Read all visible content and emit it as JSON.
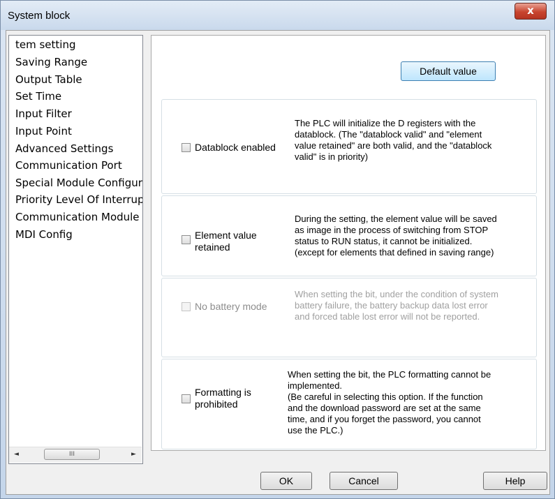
{
  "window": {
    "title": "System block",
    "close_label": "x"
  },
  "sidebar": {
    "items": [
      {
        "label": "tem setting"
      },
      {
        "label": "Saving Range"
      },
      {
        "label": "Output Table"
      },
      {
        "label": "Set Time"
      },
      {
        "label": "Input Filter"
      },
      {
        "label": "Input Point"
      },
      {
        "label": "Advanced Settings"
      },
      {
        "label": "Communication Port"
      },
      {
        "label": "Special Module Configur"
      },
      {
        "label": "Priority Level Of Interrupt"
      },
      {
        "label": "Communication Module"
      },
      {
        "label": "MDI Config"
      }
    ],
    "scroll": {
      "left": "◄",
      "right": "►",
      "thumb": "III"
    }
  },
  "main": {
    "default_button": "Default value",
    "options": [
      {
        "label": "Datablock enabled",
        "checked": false,
        "enabled": true,
        "description": "The PLC will initialize the D registers with the\ndatablock. (The \"datablock valid\" and \"element\nvalue retained\" are both valid, and the \"datablock\nvalid\" is in priority)"
      },
      {
        "label": "Element value\nretained",
        "checked": false,
        "enabled": true,
        "description": "During the setting, the element value will be saved\nas image in the process of switching from STOP\nstatus to RUN status, it cannot be initialized.\n(except for elements that defined in saving range)"
      },
      {
        "label": "No battery mode",
        "checked": false,
        "enabled": false,
        "description": "When setting the bit, under the condition of system\nbattery failure, the battery backup data lost error\nand forced table lost error will not be reported."
      },
      {
        "label": "Formatting is\nprohibited",
        "checked": false,
        "enabled": true,
        "description": "When setting the bit, the PLC formatting cannot be\nimplemented.\n (Be careful in selecting this option. If the function\nand the download password are set at the same\ntime, and if you forget the password, you cannot\nuse the PLC.)"
      }
    ]
  },
  "footer": {
    "ok": "OK",
    "cancel": "Cancel",
    "help": "Help"
  }
}
